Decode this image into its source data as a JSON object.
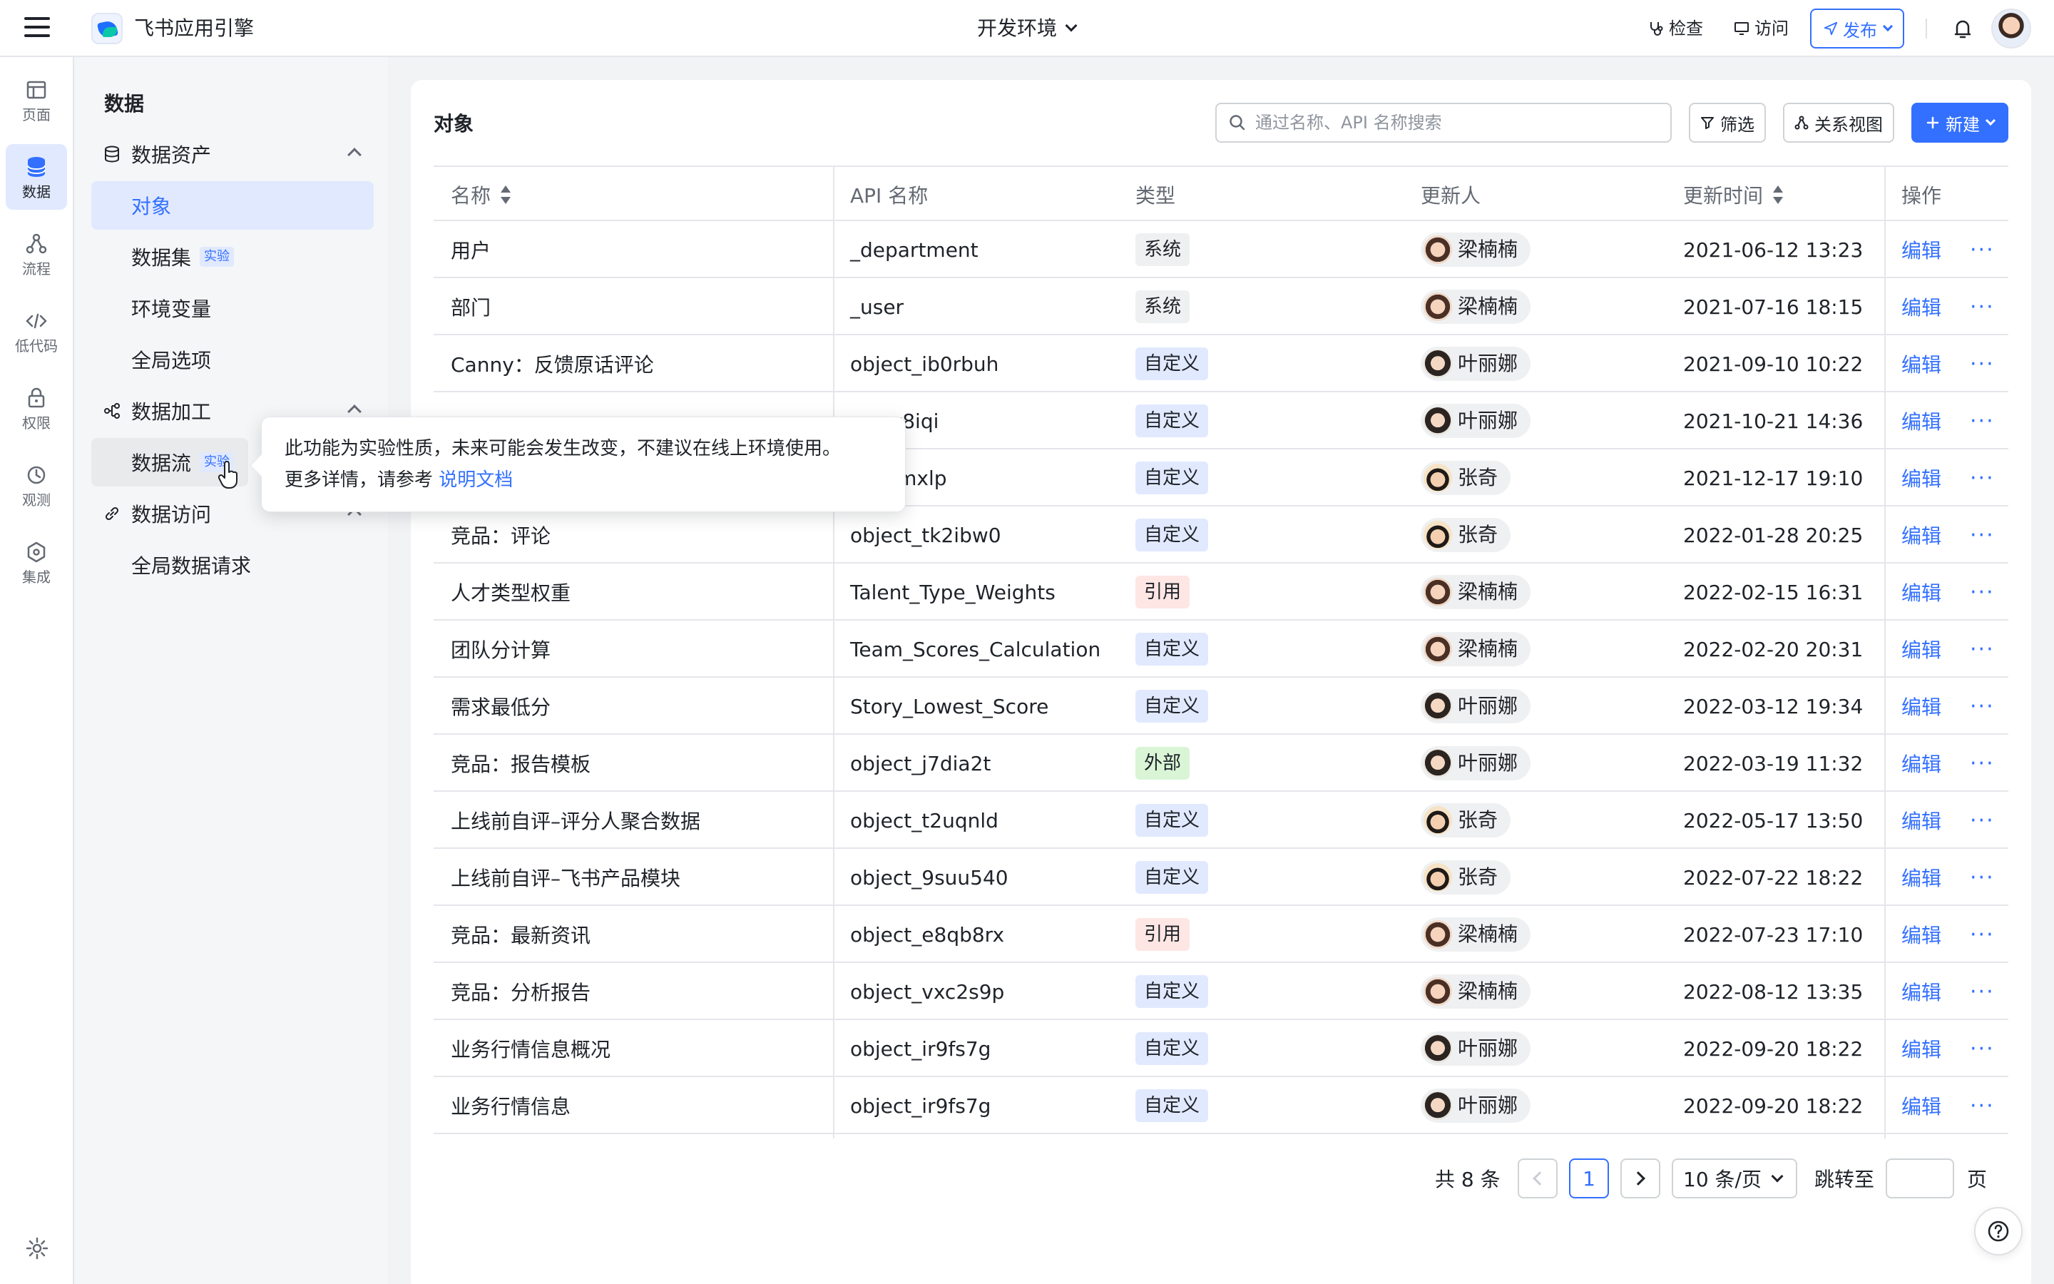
{
  "app": {
    "title": "飞书应用引擎",
    "environment": "开发环境"
  },
  "topbar": {
    "inspect": "检查",
    "visit": "访问",
    "publish": "发布"
  },
  "rail": [
    {
      "label": "页面",
      "icon": "layout-icon"
    },
    {
      "label": "数据",
      "icon": "database-icon"
    },
    {
      "label": "流程",
      "icon": "flow-icon"
    },
    {
      "label": "低代码",
      "icon": "code-icon"
    },
    {
      "label": "权限",
      "icon": "lock-icon"
    },
    {
      "label": "观测",
      "icon": "observe-icon"
    },
    {
      "label": "集成",
      "icon": "integration-icon"
    }
  ],
  "sidebar": {
    "title": "数据",
    "group_assets": "数据资产",
    "item_objects": "对象",
    "item_datasets": "数据集",
    "item_env_vars": "环境变量",
    "item_global_options": "全局选项",
    "group_processing": "数据加工",
    "item_dataflow": "数据流",
    "group_access": "数据访问",
    "item_global_requests": "全局数据请求",
    "tag_experimental": "实验"
  },
  "tooltip": {
    "line1": "此功能为实验性质，未来可能会发生改变，不建议在线上环境使用。",
    "line2": "更多详情，请参考",
    "link": "说明文档"
  },
  "main": {
    "title": "对象",
    "search_placeholder": "通过名称、API 名称搜索",
    "filter": "筛选",
    "relation_view": "关系视图",
    "new": "新建"
  },
  "table": {
    "headers": {
      "name": "名称",
      "api": "API 名称",
      "type": "类型",
      "updater": "更新人",
      "time": "更新时间",
      "op": "操作"
    },
    "edit_label": "编辑",
    "more_label": "···",
    "rows": [
      {
        "name": "用户",
        "api": "_department",
        "type": "系统",
        "updater": "梁楠楠",
        "time": "2021-06-12 13:23"
      },
      {
        "name": "部门",
        "api": "_user",
        "type": "系统",
        "updater": "梁楠楠",
        "time": "2021-07-16 18:15"
      },
      {
        "name": "Canny：反馈原话评论",
        "api": "object_ib0rbuh",
        "type": "自定义",
        "updater": "叶丽娜",
        "time": "2021-09-10 10:22"
      },
      {
        "name": "",
        "api": "_mcv8iqi",
        "type": "自定义",
        "updater": "叶丽娜",
        "time": "2021-10-21 14:36"
      },
      {
        "name": "",
        "api": "_d3ymxlp",
        "type": "自定义",
        "updater": "张奇",
        "time": "2021-12-17 19:10"
      },
      {
        "name": "竞品：评论",
        "api": "object_tk2ibw0",
        "type": "自定义",
        "updater": "张奇",
        "time": "2022-01-28 20:25"
      },
      {
        "name": "人才类型权重",
        "api": "Talent_Type_Weights",
        "type": "引用",
        "updater": "梁楠楠",
        "time": "2022-02-15 16:31"
      },
      {
        "name": "团队分计算",
        "api": "Team_Scores_Calculation",
        "type": "自定义",
        "updater": "梁楠楠",
        "time": "2022-02-20 20:31"
      },
      {
        "name": "需求最低分",
        "api": "Story_Lowest_Score",
        "type": "自定义",
        "updater": "叶丽娜",
        "time": "2022-03-12 19:34"
      },
      {
        "name": "竞品：报告模板",
        "api": "object_j7dia2t",
        "type": "外部",
        "updater": "叶丽娜",
        "time": "2022-03-19 11:32"
      },
      {
        "name": "上线前自评–评分人聚合数据",
        "api": "object_t2uqnld",
        "type": "自定义",
        "updater": "张奇",
        "time": "2022-05-17 13:50"
      },
      {
        "name": "上线前自评–飞书产品模块",
        "api": "object_9suu540",
        "type": "自定义",
        "updater": "张奇",
        "time": "2022-07-22 18:22"
      },
      {
        "name": "竞品：最新资讯",
        "api": "object_e8qb8rx",
        "type": "引用",
        "updater": "梁楠楠",
        "time": "2022-07-23 17:10"
      },
      {
        "name": "竞品：分析报告",
        "api": "object_vxc2s9p",
        "type": "自定义",
        "updater": "梁楠楠",
        "time": "2022-08-12 13:35"
      },
      {
        "name": "业务行情信息概况",
        "api": "object_ir9fs7g",
        "type": "自定义",
        "updater": "叶丽娜",
        "time": "2022-09-20 18:22"
      },
      {
        "name": "业务行情信息",
        "api": "object_ir9fs7g",
        "type": "自定义",
        "updater": "叶丽娜",
        "time": "2022-09-20 18:22"
      }
    ]
  },
  "pagination": {
    "total": "共 8 条",
    "current": "1",
    "page_size": "10 条/页",
    "jump_label": "跳转至",
    "page_suffix": "页"
  },
  "colors": {
    "accent": "#3370ff",
    "tag_system": "#eff0f1",
    "tag_custom": "#e1e9ff",
    "tag_reference": "#fde6e4",
    "tag_external": "#d9f5d6"
  }
}
